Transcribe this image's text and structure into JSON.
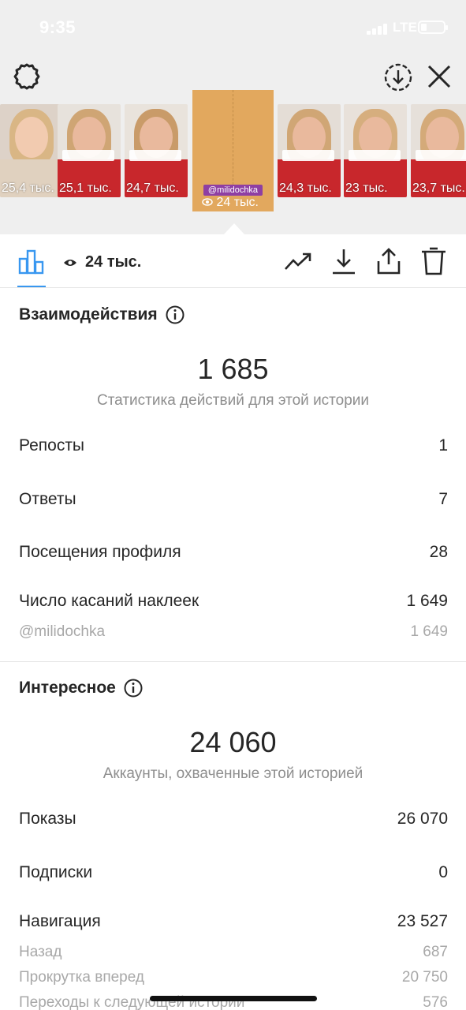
{
  "status_bar": {
    "time": "9:35",
    "network": "LTE"
  },
  "header": {
    "settings_icon": "settings-gear-icon",
    "download_icon": "download-circle-icon",
    "close_icon": "close-icon"
  },
  "stories_strip": {
    "thumbnails": [
      {
        "views": "25,4 тыс."
      },
      {
        "views": "25,1 тыс."
      },
      {
        "views": "24,7 тыс."
      },
      {
        "views": "24,3 тыс."
      },
      {
        "views": "23 тыс."
      },
      {
        "views": "23,7 тыс."
      }
    ],
    "current": {
      "sticker": "@milidochka",
      "views": "24 тыс."
    }
  },
  "tabbar": {
    "views": "24 тыс.",
    "accent_color": "#3897f0"
  },
  "interactions": {
    "title": "Взаимодействия",
    "total": "1 685",
    "caption": "Статистика действий для этой истории",
    "rows": [
      {
        "label": "Репосты",
        "value": "1"
      },
      {
        "label": "Ответы",
        "value": "7"
      },
      {
        "label": "Посещения профиля",
        "value": "28"
      },
      {
        "label": "Число касаний наклеек",
        "value": "1 649"
      }
    ],
    "sub_row": {
      "label": "@milidochka",
      "value": "1 649"
    }
  },
  "discovery": {
    "title": "Интересное",
    "total": "24 060",
    "caption": "Аккаунты, охваченные этой историей",
    "rows": [
      {
        "label": "Показы",
        "value": "26 070"
      },
      {
        "label": "Подписки",
        "value": "0"
      },
      {
        "label": "Навигация",
        "value": "23 527"
      }
    ],
    "sub_rows": [
      {
        "label": "Назад",
        "value": "687"
      },
      {
        "label": "Прокрутка вперед",
        "value": "20 750"
      },
      {
        "label": "Переходы к следующей истории",
        "value": "576"
      }
    ]
  }
}
